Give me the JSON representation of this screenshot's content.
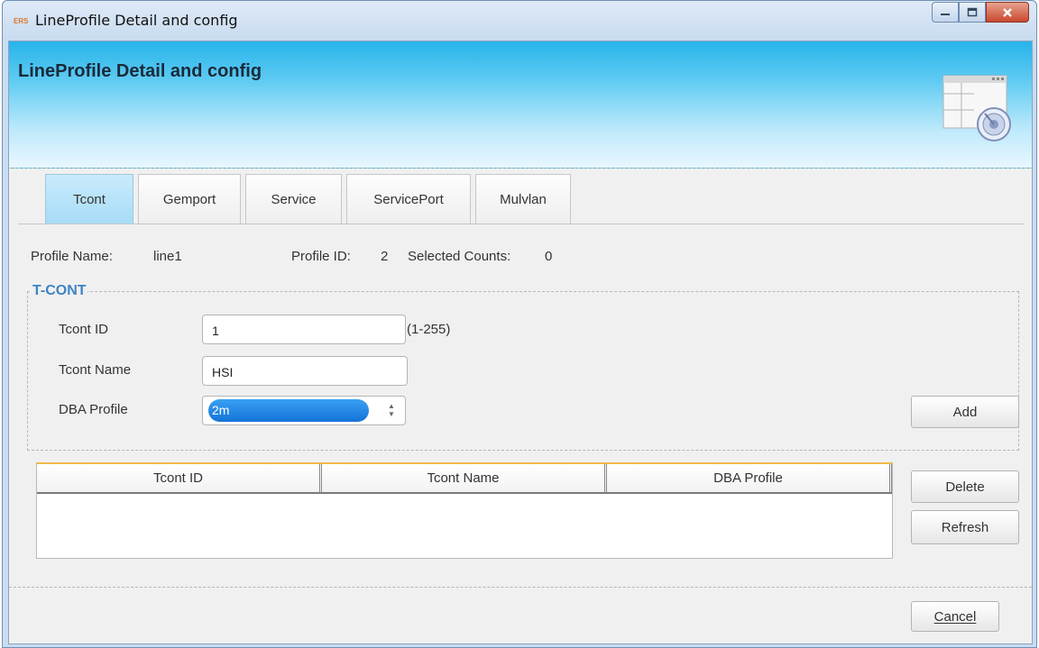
{
  "window": {
    "title": "LineProfile Detail and config",
    "app_icon_text": "ERS"
  },
  "banner": {
    "title": "LineProfile Detail and config"
  },
  "tabs": [
    {
      "label": "Tcont",
      "active": true
    },
    {
      "label": "Gemport",
      "active": false
    },
    {
      "label": "Service",
      "active": false
    },
    {
      "label": "ServicePort",
      "active": false
    },
    {
      "label": "Mulvlan",
      "active": false
    }
  ],
  "info": {
    "profile_name_label": "Profile Name:",
    "profile_name_value": "line1",
    "profile_id_label": "Profile ID:",
    "profile_id_value": "2",
    "selected_counts_label": "Selected Counts:",
    "selected_counts_value": "0"
  },
  "tcont": {
    "group_title": "T-CONT",
    "id_label": "Tcont ID",
    "id_value": "1",
    "id_hint": "(1-255)",
    "name_label": "Tcont Name",
    "name_value": "HSI",
    "dba_label": "DBA Profile",
    "dba_value": "2m",
    "add_label": "Add"
  },
  "table": {
    "columns": [
      "Tcont ID",
      "Tcont Name",
      "DBA Profile"
    ],
    "rows": []
  },
  "actions": {
    "delete_label": "Delete",
    "refresh_label": "Refresh",
    "cancel_label": "Cancel"
  },
  "colors": {
    "accent": "#3e84c4",
    "value_blue": "#1b2fb8",
    "selection": "#1e82e6",
    "table_top": "#f0b94a"
  }
}
